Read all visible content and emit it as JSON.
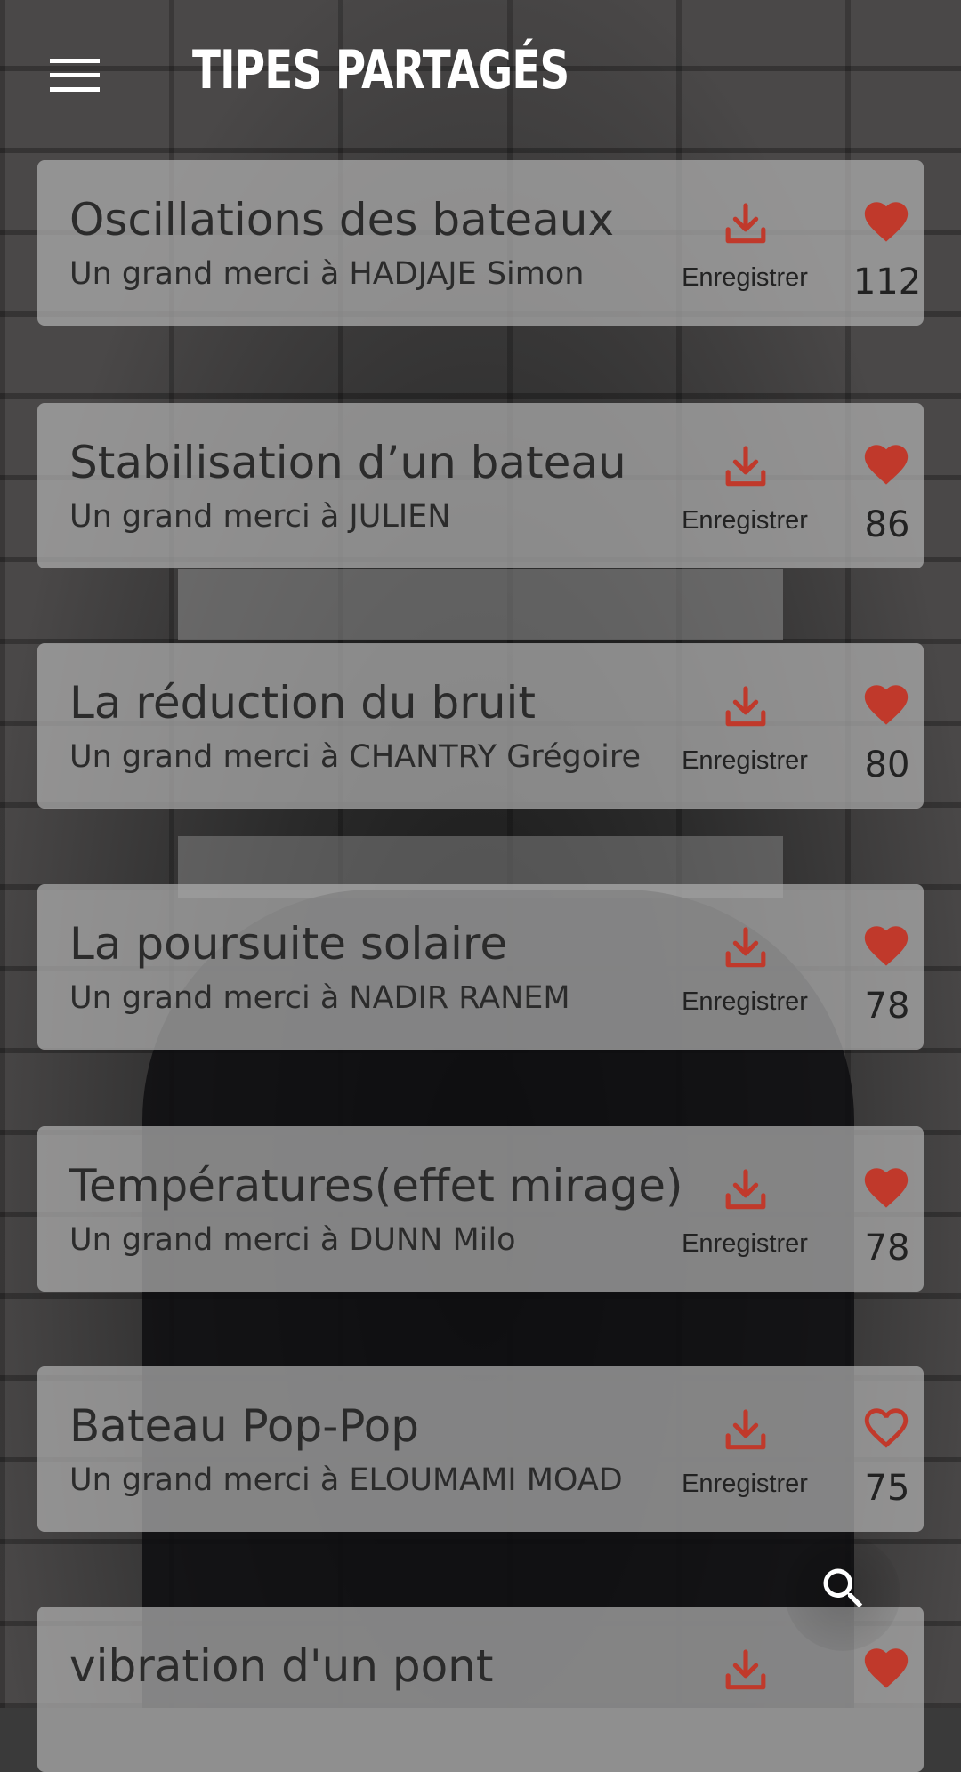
{
  "header": {
    "title": "TIPES PARTAGÉS",
    "menu_icon": "hamburger-menu-icon"
  },
  "colors": {
    "accent_red": "#c0392b",
    "card_bg": "#b0b0b0",
    "title_white": "#ffffff"
  },
  "cards": [
    {
      "title": "Oscillations des bateaux",
      "subtitle": "Un grand merci à HADJAJE Simon",
      "save_label": "Enregistrer",
      "likes": "112",
      "liked": true
    },
    {
      "title": "Stabilisation d’un bateau",
      "subtitle": "Un grand merci à JULIEN",
      "save_label": "Enregistrer",
      "likes": "86",
      "liked": true
    },
    {
      "title": "La réduction du bruit",
      "subtitle": "Un grand merci à CHANTRY Grégoire",
      "save_label": "Enregistrer",
      "likes": "80",
      "liked": true
    },
    {
      "title": "La poursuite solaire",
      "subtitle": "Un grand merci à NADIR RANEM",
      "save_label": "Enregistrer",
      "likes": "78",
      "liked": true
    },
    {
      "title": "Températures(effet mirage)",
      "subtitle": "Un grand merci à DUNN Milo",
      "save_label": "Enregistrer",
      "likes": "78",
      "liked": true
    },
    {
      "title": "Bateau Pop-Pop",
      "subtitle": "Un grand merci à ELOUMAMI MOAD",
      "save_label": "Enregistrer",
      "likes": "75",
      "liked": false
    },
    {
      "title": "vibration d'un pont",
      "subtitle": "",
      "save_label": "",
      "likes": "",
      "liked": true
    }
  ],
  "fab": {
    "icon": "search-icon"
  }
}
